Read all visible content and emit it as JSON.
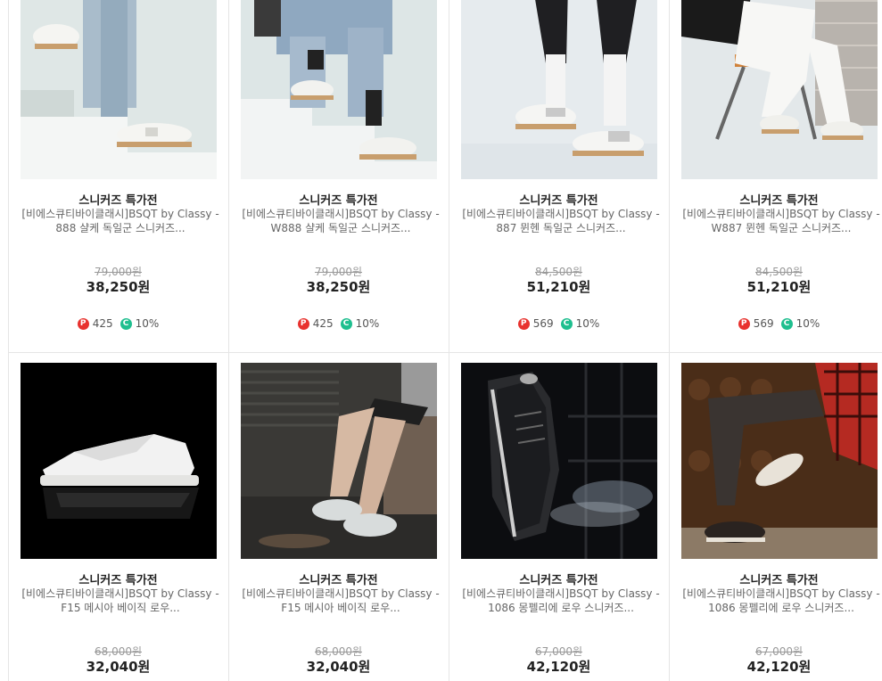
{
  "products": [
    {
      "category": "스니커즈 특가전",
      "name_line1": "[비에스큐티바이클래시]BSQT by Classy -",
      "name_line2": "888 샬케 독일군 스니커즈...",
      "original_price": "79,000원",
      "price": "38,250원",
      "points": "425",
      "coupon": "10%"
    },
    {
      "category": "스니커즈 특가전",
      "name_line1": "[비에스큐티바이클래시]BSQT by Classy -",
      "name_line2": "W888 샬케 독일군 스니커즈...",
      "original_price": "79,000원",
      "price": "38,250원",
      "points": "425",
      "coupon": "10%"
    },
    {
      "category": "스니커즈 특가전",
      "name_line1": "[비에스큐티바이클래시]BSQT by Classy -",
      "name_line2": "887 뮌헨 독일군 스니커즈...",
      "original_price": "84,500원",
      "price": "51,210원",
      "points": "569",
      "coupon": "10%"
    },
    {
      "category": "스니커즈 특가전",
      "name_line1": "[비에스큐티바이클래시]BSQT by Classy -",
      "name_line2": "W887 뮌헨 독일군 스니커즈...",
      "original_price": "84,500원",
      "price": "51,210원",
      "points": "569",
      "coupon": "10%"
    },
    {
      "category": "스니커즈 특가전",
      "name_line1": "[비에스큐티바이클래시]BSQT by Classy -",
      "name_line2": "F15 메시아 베이직 로우...",
      "original_price": "68,000원",
      "price": "32,040원"
    },
    {
      "category": "스니커즈 특가전",
      "name_line1": "[비에스큐티바이클래시]BSQT by Classy -",
      "name_line2": "F15 메시아 베이직 로우...",
      "original_price": "68,000원",
      "price": "32,040원"
    },
    {
      "category": "스니커즈 특가전",
      "name_line1": "[비에스큐티바이클래시]BSQT by Classy -",
      "name_line2": "1086 몽펠리에 로우 스니커즈...",
      "original_price": "67,000원",
      "price": "42,120원"
    },
    {
      "category": "스니커즈 특가전",
      "name_line1": "[비에스큐티바이클래시]BSQT by Classy -",
      "name_line2": "1086 몽펠리에 로우 스니커즈...",
      "original_price": "67,000원",
      "price": "42,120원"
    }
  ],
  "badge_icons": {
    "points": "P",
    "coupon": "C"
  },
  "colors": {
    "points_badge": "#e8322e",
    "coupon_badge": "#1fbf8f"
  }
}
